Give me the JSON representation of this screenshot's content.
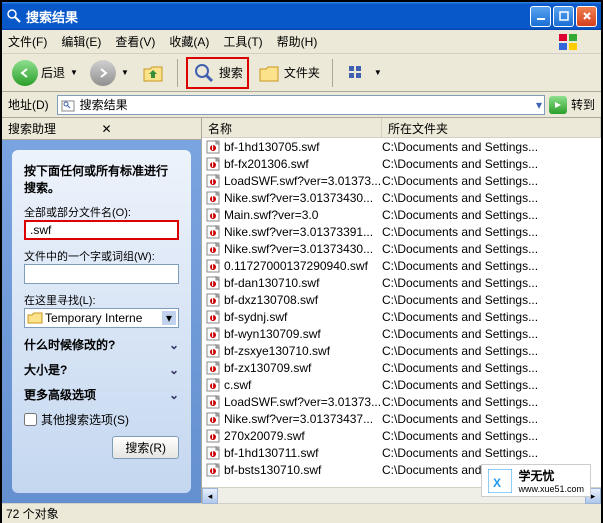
{
  "window": {
    "title": "搜索结果"
  },
  "menu": {
    "file": "文件(F)",
    "edit": "编辑(E)",
    "view": "查看(V)",
    "favorites": "收藏(A)",
    "tools": "工具(T)",
    "help": "帮助(H)"
  },
  "toolbar": {
    "back": "后退",
    "search": "搜索",
    "folders": "文件夹"
  },
  "addressbar": {
    "label": "地址(D)",
    "value": "搜索结果",
    "go": "转到"
  },
  "sidebar": {
    "title": "搜索助理",
    "heading": "按下面任何或所有标准进行搜索。",
    "filename_label": "全部或部分文件名(O):",
    "filename_value": ".swf",
    "word_label": "文件中的一个字或词组(W):",
    "lookin_label": "在这里寻找(L):",
    "lookin_value": "Temporary Interne",
    "when_modified": "什么时候修改的?",
    "size": "大小是?",
    "more_options": "更多高级选项",
    "other_options": "其他搜索选项(S)",
    "search_button": "搜索(R)"
  },
  "columns": {
    "name": "名称",
    "folder": "所在文件夹"
  },
  "files": [
    {
      "name": "bf-1hd130705.swf",
      "folder": "C:\\Documents and Settings..."
    },
    {
      "name": "bf-fx201306.swf",
      "folder": "C:\\Documents and Settings..."
    },
    {
      "name": "LoadSWF.swf?ver=3.01373...",
      "folder": "C:\\Documents and Settings..."
    },
    {
      "name": "Nike.swf?ver=3.01373430...",
      "folder": "C:\\Documents and Settings..."
    },
    {
      "name": "Main.swf?ver=3.0",
      "folder": "C:\\Documents and Settings..."
    },
    {
      "name": "Nike.swf?ver=3.01373391...",
      "folder": "C:\\Documents and Settings..."
    },
    {
      "name": "Nike.swf?ver=3.01373430...",
      "folder": "C:\\Documents and Settings..."
    },
    {
      "name": "0.11727000137290940.swf",
      "folder": "C:\\Documents and Settings..."
    },
    {
      "name": "bf-dan130710.swf",
      "folder": "C:\\Documents and Settings..."
    },
    {
      "name": "bf-dxz130708.swf",
      "folder": "C:\\Documents and Settings..."
    },
    {
      "name": "bf-sydnj.swf",
      "folder": "C:\\Documents and Settings..."
    },
    {
      "name": "bf-wyn130709.swf",
      "folder": "C:\\Documents and Settings..."
    },
    {
      "name": "bf-zsxye130710.swf",
      "folder": "C:\\Documents and Settings..."
    },
    {
      "name": "bf-zx130709.swf",
      "folder": "C:\\Documents and Settings..."
    },
    {
      "name": "c.swf",
      "folder": "C:\\Documents and Settings..."
    },
    {
      "name": "LoadSWF.swf?ver=3.01373...",
      "folder": "C:\\Documents and Settings..."
    },
    {
      "name": "Nike.swf?ver=3.01373437...",
      "folder": "C:\\Documents and Settings..."
    },
    {
      "name": "270x20079.swf",
      "folder": "C:\\Documents and Settings..."
    },
    {
      "name": "bf-1hd130711.swf",
      "folder": "C:\\Documents and Settings..."
    },
    {
      "name": "bf-bsts130710.swf",
      "folder": "C:\\Documents and Settings..."
    }
  ],
  "status": {
    "text": "72 个对象"
  },
  "watermark": {
    "text": "学无忧",
    "url": "www.xue51.com"
  }
}
